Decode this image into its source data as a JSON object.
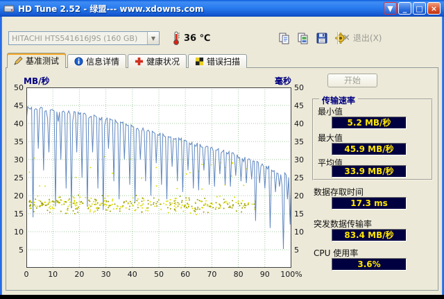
{
  "window": {
    "title": "HD Tune 2.52 - 绿盟--- www.xdowns.com",
    "controls": {
      "download": "▼",
      "minimize": "_",
      "maximize": "□",
      "close": "×"
    }
  },
  "toolbar": {
    "drive_select_value": "HITACHI HTS541616J9S (160 GB)",
    "combo_arrow": "▼",
    "temperature": "36 ℃",
    "exit_x": "×",
    "exit_label": "退出(X)"
  },
  "tabs": [
    {
      "label": "基准测试"
    },
    {
      "label": "信息详情"
    },
    {
      "label": "健康状况"
    },
    {
      "label": "错误扫描"
    }
  ],
  "panel": {
    "start_button": "开始",
    "transfer_group_title": "传输速率",
    "min_label": "最小值",
    "min_value": "5.2 MB/秒",
    "max_label": "最大值",
    "max_value": "45.9 MB/秒",
    "avg_label": "平均值",
    "avg_value": "33.9 MB/秒",
    "access_time_label": "数据存取时间",
    "access_time_value": "17.3 ms",
    "burst_rate_label": "突发数据传输率",
    "burst_rate_value": "83.4 MB/秒",
    "cpu_label": "CPU 使用率",
    "cpu_value": "3.6%"
  },
  "chart_data": {
    "type": "line",
    "y_left_label": "MB/秒",
    "y_right_label": "毫秒",
    "x_ticks": [
      "0",
      "10",
      "20",
      "30",
      "40",
      "50",
      "60",
      "70",
      "80",
      "90",
      "100%"
    ],
    "y_ticks_left": [
      50,
      45,
      40,
      35,
      30,
      25,
      20,
      15,
      10,
      5
    ],
    "y_ticks_right": [
      50,
      45,
      40,
      35,
      30,
      25,
      20,
      15,
      10,
      5
    ],
    "x_range": [
      0,
      100
    ],
    "y_range": [
      0,
      50
    ],
    "grid_color": "#a0c8a0",
    "line_stats": {
      "min": 5.2,
      "max": 45.9,
      "avg": 33.9,
      "access_time_ms": 17.3,
      "burst_rate": 83.4,
      "cpu_usage_pct": 3.6
    },
    "series": [
      {
        "name": "transfer-rate",
        "color": "#5f87c0",
        "noise_seed": 7,
        "base_anchors": [
          [
            0,
            44.5
          ],
          [
            2,
            44.2
          ],
          [
            6,
            43.9
          ],
          [
            10,
            43.6
          ],
          [
            14,
            43.2
          ],
          [
            18,
            42.8
          ],
          [
            22,
            42.3
          ],
          [
            26,
            41.7
          ],
          [
            30,
            41.0
          ],
          [
            34,
            40.3
          ],
          [
            38,
            39.5
          ],
          [
            42,
            38.7
          ],
          [
            46,
            37.9
          ],
          [
            50,
            37.1
          ],
          [
            54,
            36.3
          ],
          [
            58,
            35.5
          ],
          [
            62,
            34.6
          ],
          [
            66,
            33.8
          ],
          [
            70,
            33.0
          ],
          [
            74,
            32.2
          ],
          [
            78,
            31.4
          ],
          [
            82,
            30.5
          ],
          [
            86,
            29.5
          ],
          [
            90,
            28.2
          ],
          [
            93,
            27.2
          ],
          [
            96,
            26.2
          ],
          [
            100,
            25.2
          ]
        ],
        "spikes": [
          [
            2.5,
            14
          ],
          [
            4.5,
            33
          ],
          [
            6.5,
            27
          ],
          [
            8.5,
            32
          ],
          [
            11,
            17
          ],
          [
            13,
            30
          ],
          [
            15,
            22
          ],
          [
            17,
            16.5
          ],
          [
            19,
            32
          ],
          [
            21,
            25
          ],
          [
            23,
            17
          ],
          [
            25,
            32
          ],
          [
            27,
            22
          ],
          [
            29,
            16
          ],
          [
            31,
            33
          ],
          [
            33,
            24
          ],
          [
            35,
            19
          ],
          [
            37,
            30
          ],
          [
            39,
            23
          ],
          [
            41,
            18
          ],
          [
            43,
            30
          ],
          [
            45,
            24
          ],
          [
            47,
            20
          ],
          [
            49,
            29
          ],
          [
            51,
            23
          ],
          [
            53,
            19
          ],
          [
            55,
            28
          ],
          [
            57,
            24
          ],
          [
            59,
            21
          ],
          [
            61,
            27
          ],
          [
            63,
            22
          ],
          [
            65,
            21.5
          ],
          [
            67,
            27
          ],
          [
            69,
            23
          ],
          [
            71,
            22.5
          ],
          [
            73,
            26
          ],
          [
            75,
            23
          ],
          [
            77,
            22.5
          ],
          [
            79,
            25.5
          ],
          [
            81,
            24
          ],
          [
            83,
            23.5
          ],
          [
            85,
            24.5
          ],
          [
            86.5,
            13
          ],
          [
            88,
            23.5
          ],
          [
            90,
            22
          ],
          [
            92,
            11
          ],
          [
            94,
            21
          ],
          [
            95.5,
            22.5
          ],
          [
            97,
            5.2
          ],
          [
            98.5,
            19
          ],
          [
            99.5,
            12
          ]
        ]
      },
      {
        "name": "access-time-dots",
        "color": "#dede00",
        "color2": "#a0a000",
        "count": 380,
        "x_min": 1,
        "x_max": 87,
        "x_bias": 1.2,
        "y_mean": 17.5,
        "y_spread": 2.2,
        "y_min": 13,
        "outliers": 30,
        "outlier_max": 32,
        "seed": 99
      }
    ]
  }
}
